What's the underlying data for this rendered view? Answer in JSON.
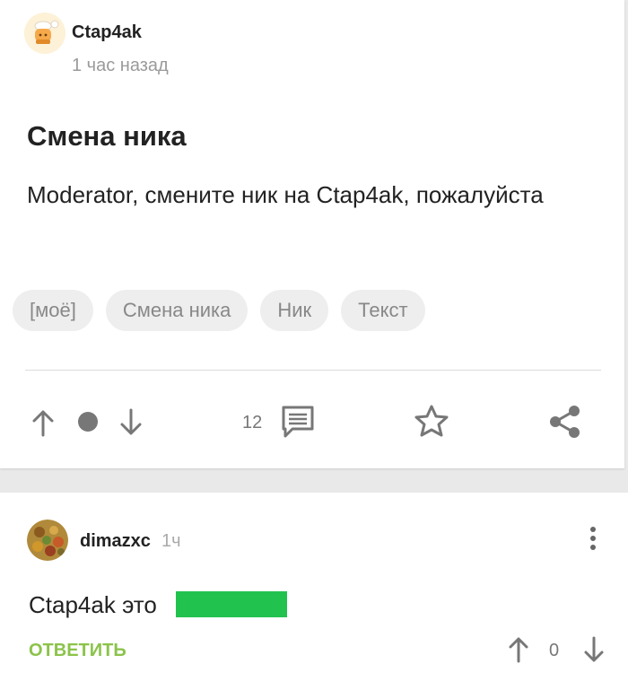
{
  "post": {
    "author": "Ctap4ak",
    "time": "1 час назад",
    "title": "Смена ника",
    "text": "Moderator, смените ник на Ctap4ak, пожалуйста",
    "tags": [
      "[моё]",
      "Смена ника",
      "Ник",
      "Текст"
    ],
    "comments_count": "12"
  },
  "comment": {
    "author": "dimazxc",
    "time": "1ч",
    "text": "Ctap4ak это",
    "reply_label": "ОТВЕТИТЬ",
    "score": "0",
    "redaction_color": "#22c24f"
  },
  "colors": {
    "accent_green": "#8bc34a",
    "icon_gray": "#777777"
  },
  "icons": {
    "upvote": "arrow-up-icon",
    "downvote": "arrow-down-icon",
    "rating": "dot-icon",
    "comments": "comment-icon",
    "save": "star-icon",
    "share": "share-icon",
    "menu": "more-vert-icon"
  }
}
